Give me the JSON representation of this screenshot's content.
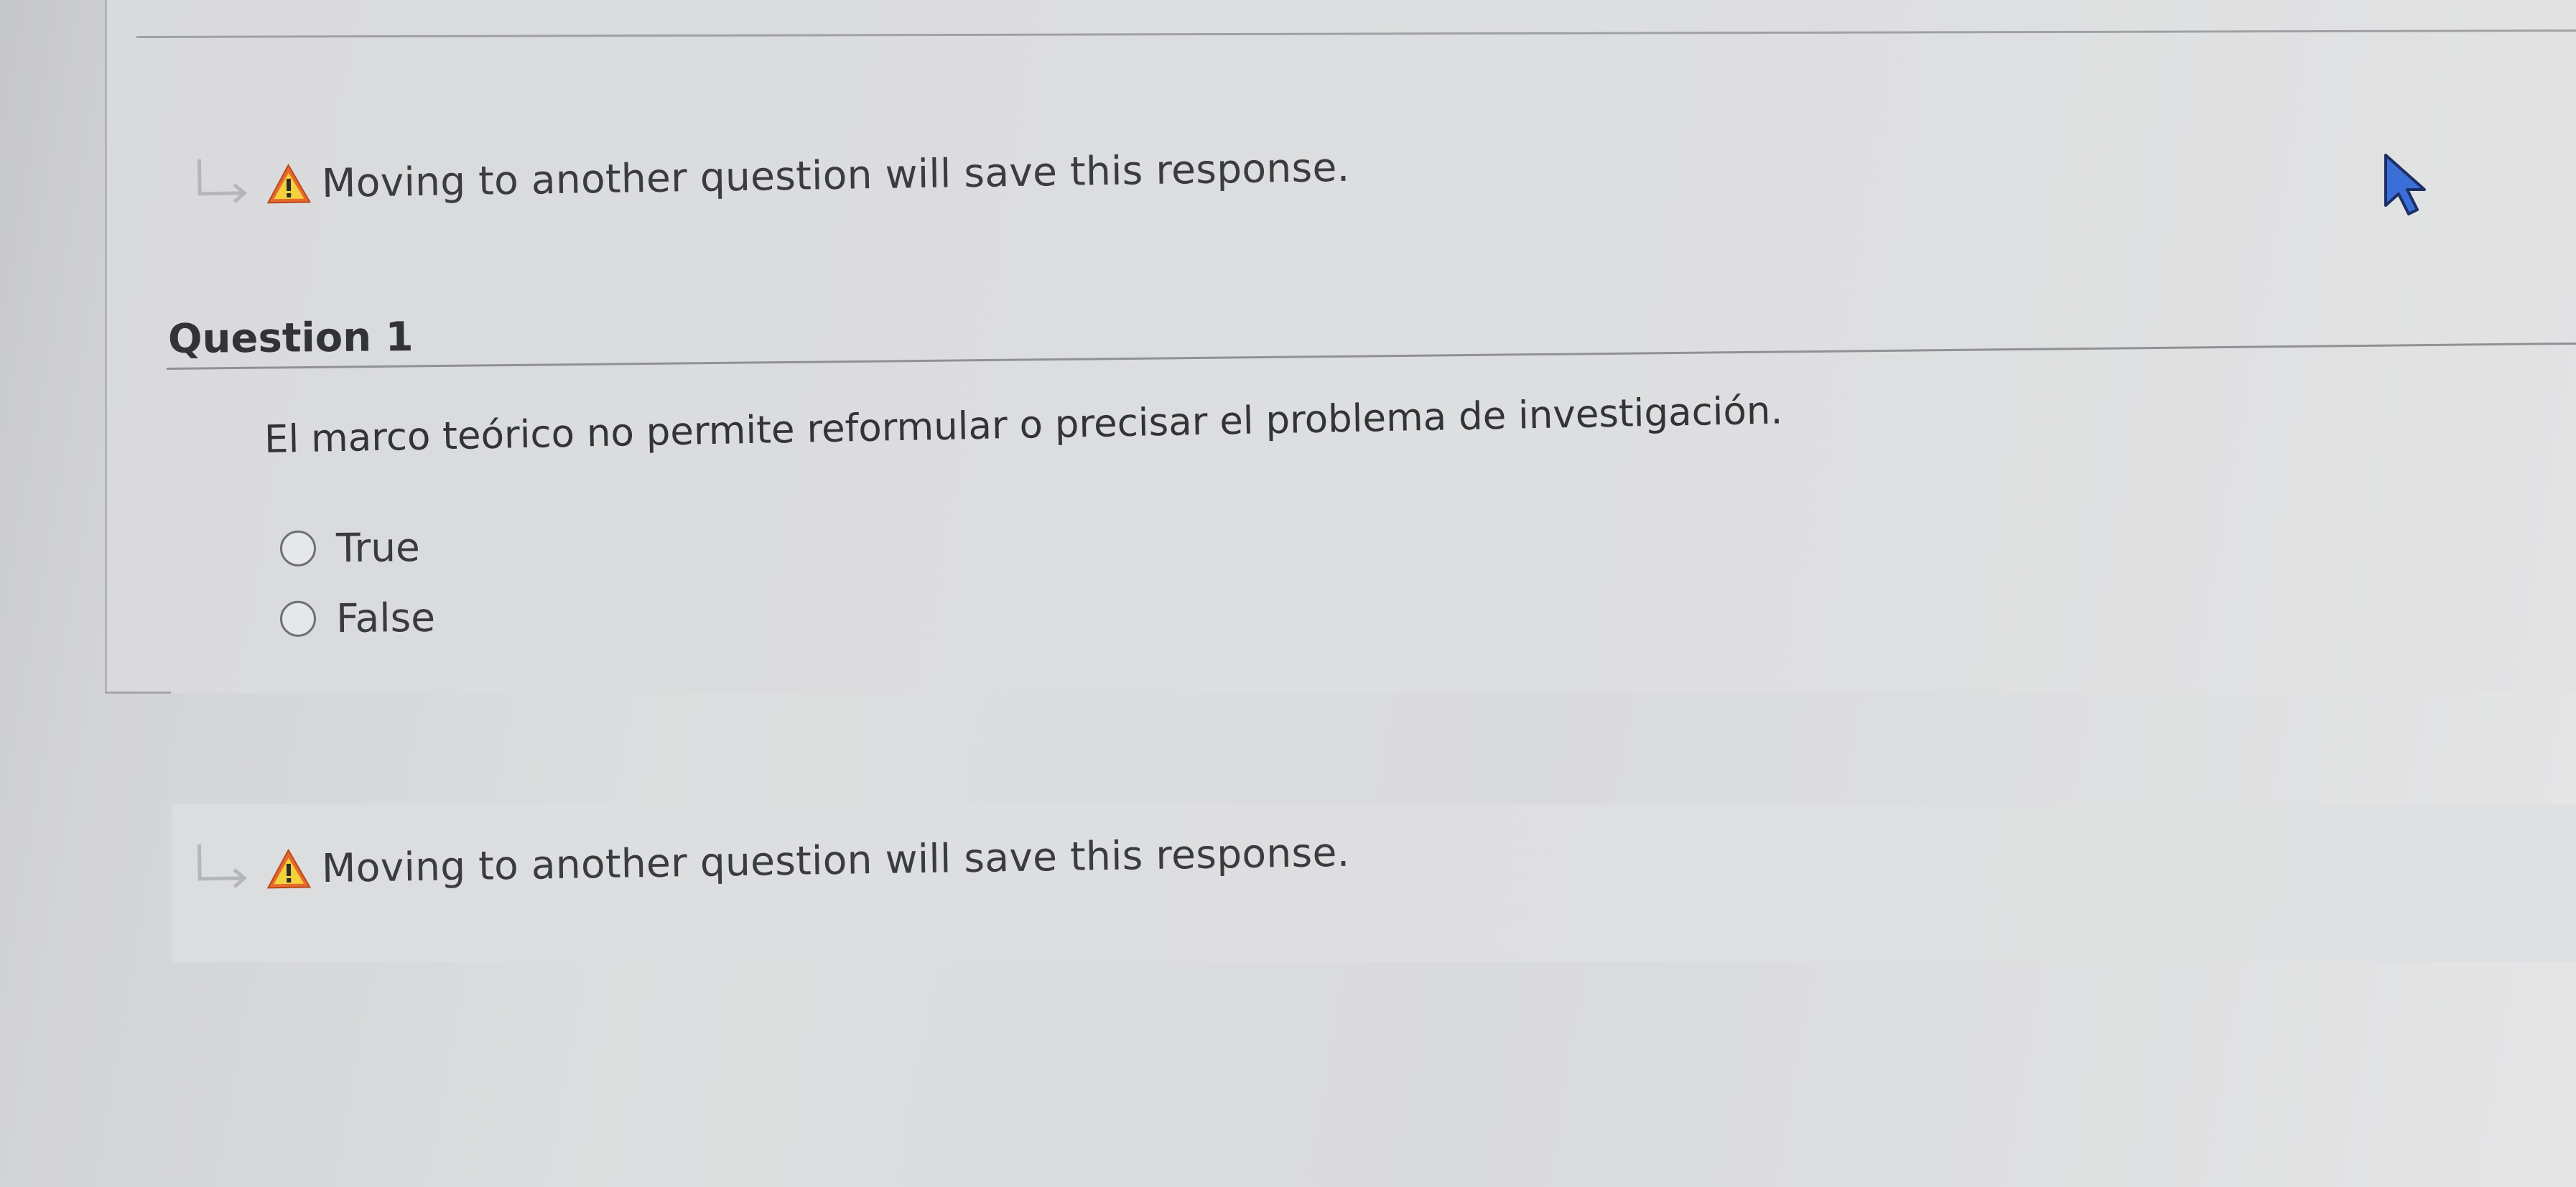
{
  "top_notice": {
    "icon_arrow": "return-arrow-icon",
    "icon_warning": "warning-icon",
    "text": "Moving to another question will save this response."
  },
  "question": {
    "title": "Question 1",
    "text": "El marco teórico no permite reformular o precisar el problema de investigación.",
    "options": [
      {
        "label": "True",
        "selected": false
      },
      {
        "label": "False",
        "selected": false
      }
    ]
  },
  "bottom_notice": {
    "icon_arrow": "return-arrow-icon",
    "icon_warning": "warning-icon",
    "text": "Moving to another question will save this response."
  },
  "colors": {
    "warning_fill": "#e8692c",
    "warning_symbol": "#f4d23c",
    "cursor_fill": "#3a6fd8"
  }
}
